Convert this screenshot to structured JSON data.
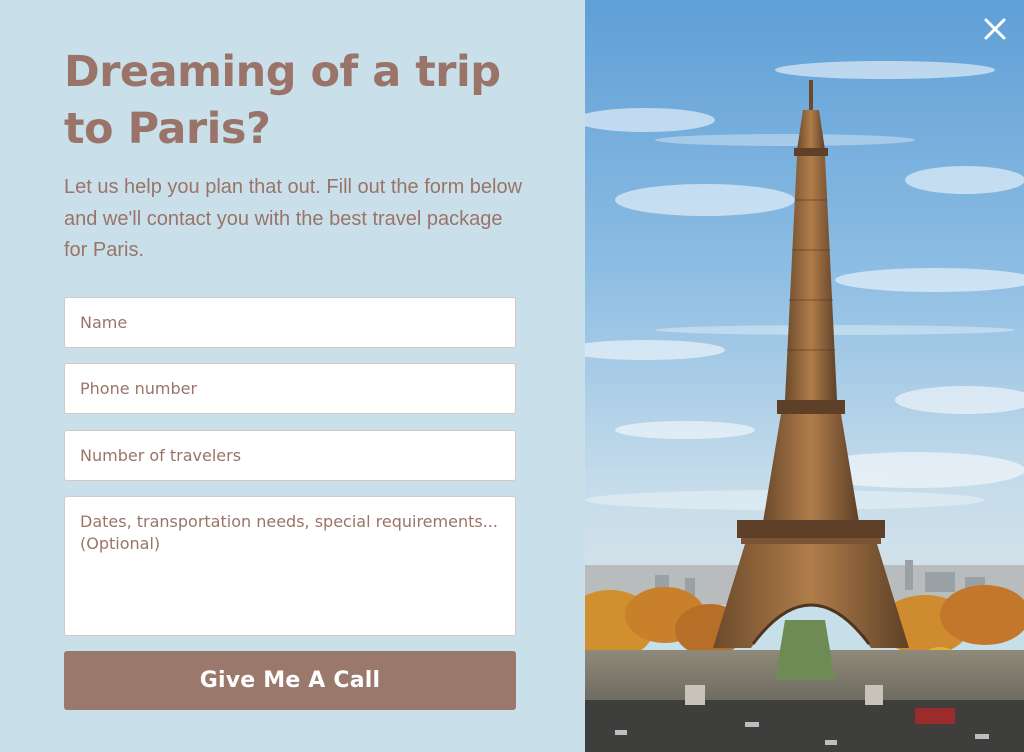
{
  "modal": {
    "title": "Dreaming of a trip to Paris?",
    "subtitle": "Let us help you plan that out. Fill out the form below and we'll contact you with the best travel package for Paris.",
    "fields": {
      "name_placeholder": "Name",
      "phone_placeholder": "Phone number",
      "travelers_placeholder": "Number of travelers",
      "details_placeholder": "Dates, transportation needs, special requirements... (Optional)"
    },
    "submit_label": "Give Me A Call",
    "close_icon": "close-icon",
    "image": "eiffel-tower-photo"
  },
  "colors": {
    "panel_background": "#c9e0ea",
    "text_accent": "#9a7468",
    "button_background": "#9a786c",
    "button_text": "#ffffff"
  }
}
